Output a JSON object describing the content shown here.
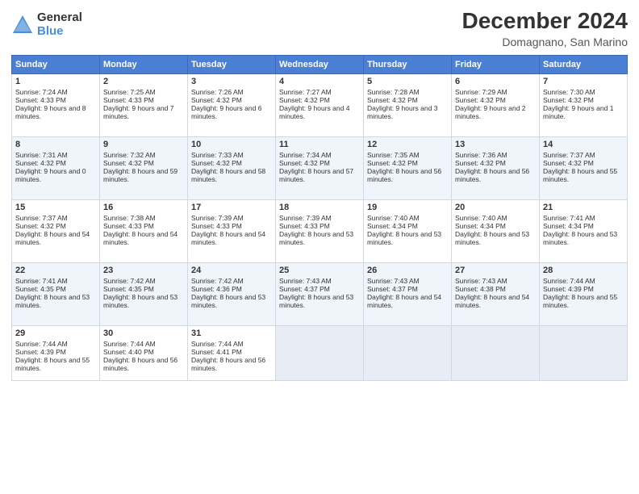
{
  "header": {
    "logo_general": "General",
    "logo_blue": "Blue",
    "month_title": "December 2024",
    "location": "Domagnano, San Marino"
  },
  "days_of_week": [
    "Sunday",
    "Monday",
    "Tuesday",
    "Wednesday",
    "Thursday",
    "Friday",
    "Saturday"
  ],
  "weeks": [
    [
      {
        "day": 1,
        "sunrise": "7:24 AM",
        "sunset": "4:33 PM",
        "daylight": "9 hours and 8 minutes."
      },
      {
        "day": 2,
        "sunrise": "7:25 AM",
        "sunset": "4:33 PM",
        "daylight": "9 hours and 7 minutes."
      },
      {
        "day": 3,
        "sunrise": "7:26 AM",
        "sunset": "4:32 PM",
        "daylight": "9 hours and 6 minutes."
      },
      {
        "day": 4,
        "sunrise": "7:27 AM",
        "sunset": "4:32 PM",
        "daylight": "9 hours and 4 minutes."
      },
      {
        "day": 5,
        "sunrise": "7:28 AM",
        "sunset": "4:32 PM",
        "daylight": "9 hours and 3 minutes."
      },
      {
        "day": 6,
        "sunrise": "7:29 AM",
        "sunset": "4:32 PM",
        "daylight": "9 hours and 2 minutes."
      },
      {
        "day": 7,
        "sunrise": "7:30 AM",
        "sunset": "4:32 PM",
        "daylight": "9 hours and 1 minute."
      }
    ],
    [
      {
        "day": 8,
        "sunrise": "7:31 AM",
        "sunset": "4:32 PM",
        "daylight": "9 hours and 0 minutes."
      },
      {
        "day": 9,
        "sunrise": "7:32 AM",
        "sunset": "4:32 PM",
        "daylight": "8 hours and 59 minutes."
      },
      {
        "day": 10,
        "sunrise": "7:33 AM",
        "sunset": "4:32 PM",
        "daylight": "8 hours and 58 minutes."
      },
      {
        "day": 11,
        "sunrise": "7:34 AM",
        "sunset": "4:32 PM",
        "daylight": "8 hours and 57 minutes."
      },
      {
        "day": 12,
        "sunrise": "7:35 AM",
        "sunset": "4:32 PM",
        "daylight": "8 hours and 56 minutes."
      },
      {
        "day": 13,
        "sunrise": "7:36 AM",
        "sunset": "4:32 PM",
        "daylight": "8 hours and 56 minutes."
      },
      {
        "day": 14,
        "sunrise": "7:37 AM",
        "sunset": "4:32 PM",
        "daylight": "8 hours and 55 minutes."
      }
    ],
    [
      {
        "day": 15,
        "sunrise": "7:37 AM",
        "sunset": "4:32 PM",
        "daylight": "8 hours and 54 minutes."
      },
      {
        "day": 16,
        "sunrise": "7:38 AM",
        "sunset": "4:33 PM",
        "daylight": "8 hours and 54 minutes."
      },
      {
        "day": 17,
        "sunrise": "7:39 AM",
        "sunset": "4:33 PM",
        "daylight": "8 hours and 54 minutes."
      },
      {
        "day": 18,
        "sunrise": "7:39 AM",
        "sunset": "4:33 PM",
        "daylight": "8 hours and 53 minutes."
      },
      {
        "day": 19,
        "sunrise": "7:40 AM",
        "sunset": "4:34 PM",
        "daylight": "8 hours and 53 minutes."
      },
      {
        "day": 20,
        "sunrise": "7:40 AM",
        "sunset": "4:34 PM",
        "daylight": "8 hours and 53 minutes."
      },
      {
        "day": 21,
        "sunrise": "7:41 AM",
        "sunset": "4:34 PM",
        "daylight": "8 hours and 53 minutes."
      }
    ],
    [
      {
        "day": 22,
        "sunrise": "7:41 AM",
        "sunset": "4:35 PM",
        "daylight": "8 hours and 53 minutes."
      },
      {
        "day": 23,
        "sunrise": "7:42 AM",
        "sunset": "4:35 PM",
        "daylight": "8 hours and 53 minutes."
      },
      {
        "day": 24,
        "sunrise": "7:42 AM",
        "sunset": "4:36 PM",
        "daylight": "8 hours and 53 minutes."
      },
      {
        "day": 25,
        "sunrise": "7:43 AM",
        "sunset": "4:37 PM",
        "daylight": "8 hours and 53 minutes."
      },
      {
        "day": 26,
        "sunrise": "7:43 AM",
        "sunset": "4:37 PM",
        "daylight": "8 hours and 54 minutes."
      },
      {
        "day": 27,
        "sunrise": "7:43 AM",
        "sunset": "4:38 PM",
        "daylight": "8 hours and 54 minutes."
      },
      {
        "day": 28,
        "sunrise": "7:44 AM",
        "sunset": "4:39 PM",
        "daylight": "8 hours and 55 minutes."
      }
    ],
    [
      {
        "day": 29,
        "sunrise": "7:44 AM",
        "sunset": "4:39 PM",
        "daylight": "8 hours and 55 minutes."
      },
      {
        "day": 30,
        "sunrise": "7:44 AM",
        "sunset": "4:40 PM",
        "daylight": "8 hours and 56 minutes."
      },
      {
        "day": 31,
        "sunrise": "7:44 AM",
        "sunset": "4:41 PM",
        "daylight": "8 hours and 56 minutes."
      },
      null,
      null,
      null,
      null
    ]
  ]
}
